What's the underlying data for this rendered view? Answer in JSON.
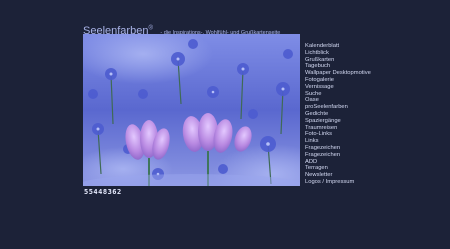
{
  "header": {
    "title": "Seelenfarben",
    "title_mark": "®",
    "subtitle": "- die Inspirations-, Wohlfühl- und Grußkartenseite"
  },
  "photo": {
    "subject": "purple-blue-flowers-photo",
    "colors": {
      "sky": "#5f6fd8",
      "flower": "#b08ae0",
      "leaf": "#3a6b4a"
    }
  },
  "counter": {
    "value": "55448362"
  },
  "nav": {
    "items": [
      "Kalenderblatt",
      "Lichtblick",
      "Grußkarten",
      "Tagebuch",
      "Wallpaper Desktopmotive",
      "Fotogalerie",
      "Vernissage",
      "Suche",
      "Oase",
      "proSeelenfarben",
      "Gedichte",
      "Spaziergänge",
      "Traumreisen",
      "Foto-Links",
      "Links",
      "Fragezeichen",
      "Fragezeichen",
      "ADD",
      "Terragen",
      "Newsletter",
      "Logos / Impressum"
    ]
  }
}
